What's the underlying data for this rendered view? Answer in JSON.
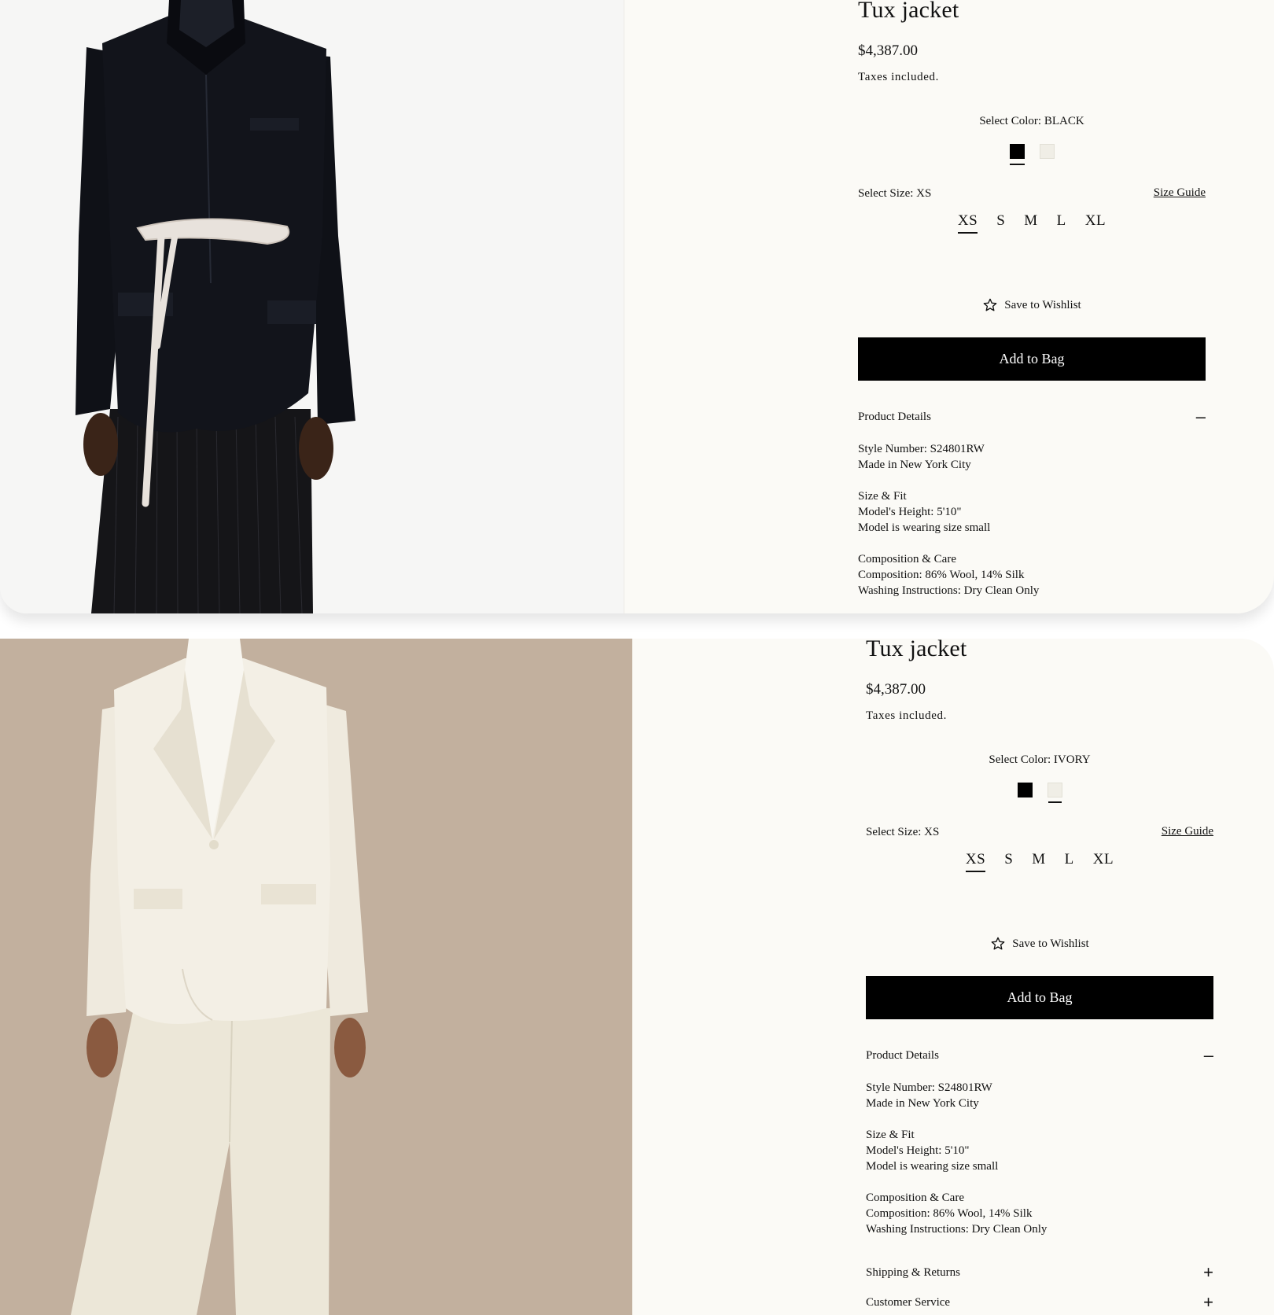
{
  "panels": [
    {
      "product": {
        "title": "Tux jacket",
        "price": "$4,387.00",
        "tax_note": "Taxes included."
      },
      "color": {
        "label": "Select Color: BLACK",
        "swatches": [
          "black",
          "ivory"
        ],
        "selected": "black"
      },
      "size": {
        "label": "Select Size: XS",
        "guide_link": "Size Guide",
        "options": [
          "XS",
          "S",
          "M",
          "L",
          "XL"
        ],
        "selected": "XS"
      },
      "wishlist_label": "Save to Wishlist",
      "add_to_bag_label": "Add to Bag",
      "details": {
        "heading": "Product Details",
        "toggle": "–",
        "style_number": "Style Number: S24801RW",
        "made_in": "Made in New York City",
        "size_fit_heading": "Size & Fit",
        "model_height": "Model's Height: 5'10\"",
        "model_size": "Model is wearing size small",
        "composition_heading": "Composition & Care",
        "composition": "Composition:  86% Wool, 14% Silk",
        "washing": "Washing Instructions: Dry Clean Only"
      }
    },
    {
      "product": {
        "title": "Tux jacket",
        "price": "$4,387.00",
        "tax_note": "Taxes included."
      },
      "color": {
        "label": "Select Color: IVORY",
        "swatches": [
          "black",
          "ivory"
        ],
        "selected": "ivory"
      },
      "size": {
        "label": "Select Size: XS",
        "guide_link": "Size Guide",
        "options": [
          "XS",
          "S",
          "M",
          "L",
          "XL"
        ],
        "selected": "XS"
      },
      "wishlist_label": "Save to Wishlist",
      "add_to_bag_label": "Add to Bag",
      "details": {
        "heading": "Product Details",
        "toggle": "–",
        "style_number": "Style Number: S24801RW",
        "made_in": "Made in New York City",
        "size_fit_heading": "Size & Fit",
        "model_height": "Model's Height: 5'10\"",
        "model_size": "Model is wearing size small",
        "composition_heading": "Composition & Care",
        "composition": "Composition:  86% Wool, 14% Silk",
        "washing": "Washing Instructions: Dry Clean Only"
      },
      "accordions": [
        {
          "label": "Shipping & Returns",
          "toggle": "+"
        },
        {
          "label": "Customer Service",
          "toggle": "+"
        }
      ]
    }
  ],
  "colors": {
    "swatch_black": "#000000",
    "swatch_ivory": "#f0eee6",
    "button_bg": "#000000",
    "page_bg": "#fbfaf6",
    "photo_bg_2": "#c2b09e"
  }
}
